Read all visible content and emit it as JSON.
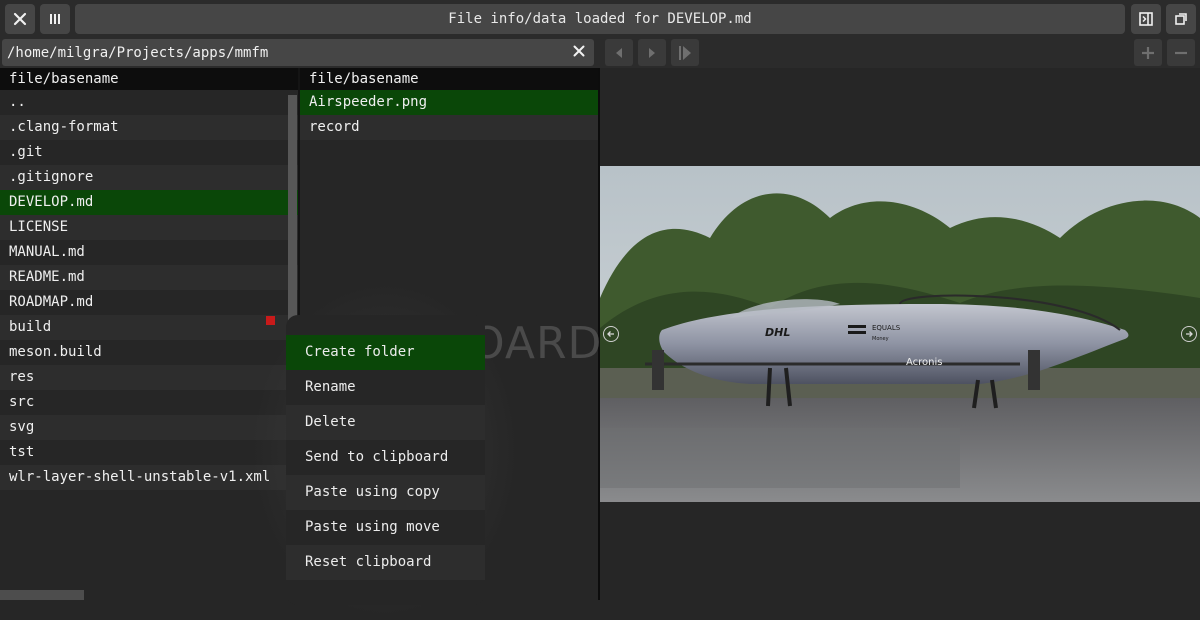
{
  "window": {
    "title": "File info/data loaded for DEVELOP.md"
  },
  "toolbar": {
    "close_icon": "close-icon",
    "columns_icon": "columns-icon",
    "toggle_preview_icon": "panel-toggle-icon",
    "fullscreen_icon": "fullscreen-icon"
  },
  "path": {
    "value": "/home/milgra/Projects/apps/mmfm"
  },
  "left_pane": {
    "header": "file/basename",
    "items": [
      {
        "name": ".."
      },
      {
        "name": ".clang-format"
      },
      {
        "name": ".git"
      },
      {
        "name": ".gitignore"
      },
      {
        "name": "DEVELOP.md",
        "selected": true
      },
      {
        "name": "LICENSE"
      },
      {
        "name": "MANUAL.md"
      },
      {
        "name": "README.md"
      },
      {
        "name": "ROADMAP.md"
      },
      {
        "name": "build"
      },
      {
        "name": "meson.build"
      },
      {
        "name": "res"
      },
      {
        "name": "src"
      },
      {
        "name": "svg"
      },
      {
        "name": "tst"
      },
      {
        "name": "wlr-layer-shell-unstable-v1.xml"
      }
    ]
  },
  "mid_pane": {
    "header": "file/basename",
    "items": [
      {
        "name": "Airspeeder.png",
        "selected": true
      },
      {
        "name": "record"
      }
    ]
  },
  "watermark": "OARD",
  "context_menu": {
    "items": [
      {
        "label": "Create folder",
        "selected": true
      },
      {
        "label": "Rename"
      },
      {
        "label": "Delete"
      },
      {
        "label": "Send to clipboard"
      },
      {
        "label": "Paste using copy"
      },
      {
        "label": "Paste using move"
      },
      {
        "label": "Reset clipboard"
      }
    ]
  },
  "preview": {
    "image_label": "Airspeeder.png",
    "livery": {
      "brand1": "DHL",
      "brand2": "EQUALS",
      "brand2_sub": "Money",
      "brand3": "Acronis"
    }
  },
  "colors": {
    "selected_row": "#0a4708",
    "button_bg": "#464646",
    "background": "#262626"
  }
}
